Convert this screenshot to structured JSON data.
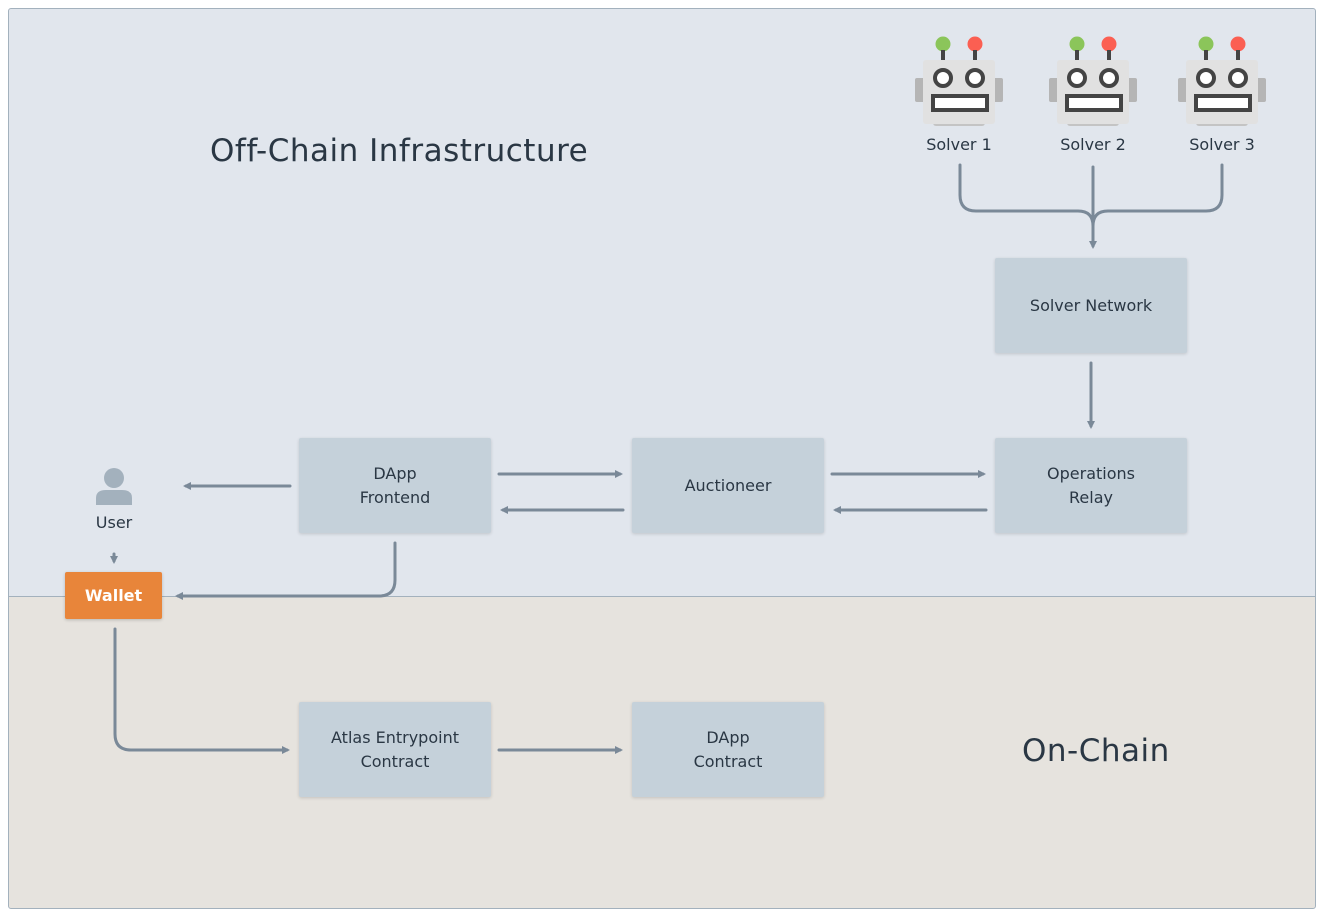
{
  "regions": {
    "offchain": "Off-Chain Infrastructure",
    "onchain": "On-Chain"
  },
  "solvers": [
    "Solver 1",
    "Solver 2",
    "Solver 3"
  ],
  "boxes": {
    "solver_network": "Solver Network",
    "dapp_frontend": "DApp\nFrontend",
    "auctioneer": "Auctioneer",
    "operations_relay": "Operations\nRelay",
    "atlas_entrypoint": "Atlas Entrypoint\nContract",
    "dapp_contract": "DApp\nContract"
  },
  "user": "User",
  "wallet": "Wallet",
  "colors": {
    "offchain_bg": "#e1e6ed",
    "onchain_bg": "#e6e3de",
    "box": "#c5d1da",
    "wallet": "#e8853a",
    "arrow": "#7a8998"
  }
}
